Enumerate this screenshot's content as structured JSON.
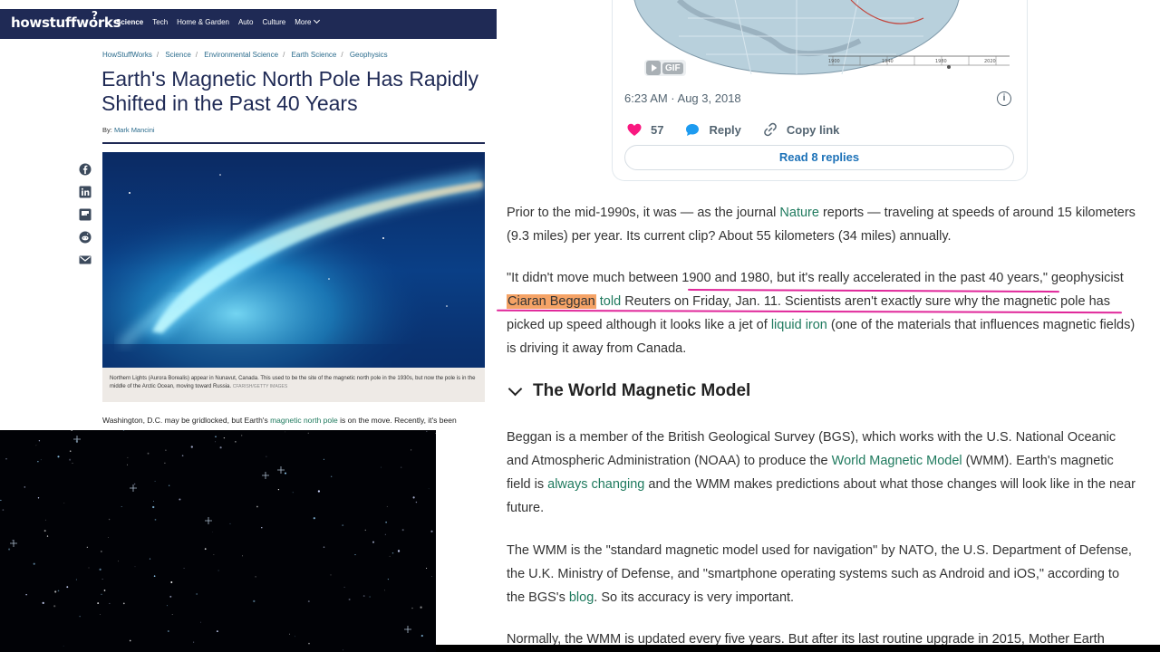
{
  "hsw": {
    "logo": "howstuffworks",
    "nav": [
      "Science",
      "Tech",
      "Home & Garden",
      "Auto",
      "Culture",
      "More"
    ],
    "breadcrumb": [
      "HowStuffWorks",
      "Science",
      "Environmental Science",
      "Earth Science",
      "Geophysics"
    ],
    "title": "Earth's Magnetic North Pole Has Rapidly Shifted in the Past 40 Years",
    "byline_prefix": "By:",
    "author": "Mark Mancini",
    "share_icons": [
      "facebook-icon",
      "linkedin-icon",
      "flipboard-icon",
      "reddit-icon",
      "email-icon"
    ],
    "caption": "Northern Lights (Aurora Borealis) appear in Nunavut, Canada. This used to be the site of the magnetic north pole in the 1930s, but now the pole is in the middle of the Arctic Ocean, moving toward Russia.",
    "caption_credit": "CFARISH/GETTY IMAGES",
    "lede_before": "Washington, D.C. may be gridlocked, but Earth's ",
    "lede_link": "magnetic north pole",
    "lede_after": " is on the move. Recently, it's been",
    "colors": {
      "topbar": "#1f2a55",
      "title": "#1f2a55",
      "link": "#2a6b8c"
    }
  },
  "tweet": {
    "gif_label": "GIF",
    "time": "6:23 AM · Aug 3, 2018",
    "likes": "57",
    "reply_label": "Reply",
    "copy_label": "Copy link",
    "read_replies": "Read 8 replies"
  },
  "article": {
    "p1": {
      "a": "Prior to the mid-1990s, it was — as the journal ",
      "link": "Nature",
      "b": " reports — traveling at speeds of around 15 kilometers (9.3 miles) per year. Its current clip? About 55 kilometers (34 miles) annually."
    },
    "p2": {
      "a": "\"It didn't move much between 1900 and 1980, but it's really accelerated in the past 40 years,\" geophysicist ",
      "highlight": "Ciaran Beggan",
      "link": "told",
      "b": " Reuters on Friday, Jan. 11. Scientists aren't exactly sure why the magnetic pole has picked up speed although it looks like a jet of ",
      "link2": "liquid iron",
      "c": " (one of the materials that influences magnetic fields) is driving it away from Canada."
    },
    "section_heading": "The World Magnetic Model",
    "p3": {
      "a": "Beggan is a member of the British Geological Survey (BGS), which works with the U.S. National Oceanic and Atmospheric Administration (NOAA) to produce the ",
      "link": "World Magnetic Model",
      "b": " (WMM). Earth's magnetic field is ",
      "link2": "always changing",
      "c": " and the WMM makes predictions about what those changes will look like in the near future."
    },
    "p4": {
      "a": "The WMM is the \"standard magnetic model used for navigation\" by NATO, the U.S. Department of Defense, the U.K. Ministry of Defense, and \"smartphone operating systems such as Android and iOS,\" according to the BGS's ",
      "link": "blog",
      "b": ". So its accuracy is very important."
    },
    "p5": "Normally, the WMM is updated every five years. But after its last routine upgrade in 2015, Mother Earth",
    "colors": {
      "link": "#1f7a5e",
      "highlight": "#f5a366",
      "annotation": "#e0279a"
    }
  }
}
